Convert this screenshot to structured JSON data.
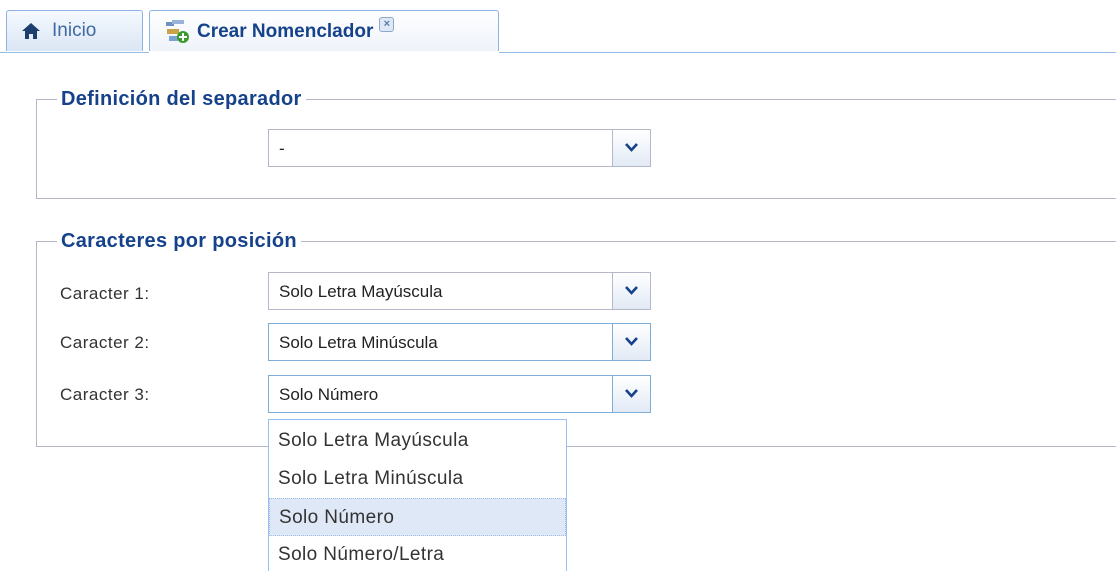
{
  "tabs": [
    {
      "label": "Inicio",
      "icon": "home-icon"
    },
    {
      "label": "Crear Nomenclador",
      "icon": "add-nomenclator-icon",
      "closable": true
    }
  ],
  "separator_section": {
    "legend": "Definición del separador",
    "combo_value": "-"
  },
  "chars_section": {
    "legend": "Caracteres por posición",
    "rows": [
      {
        "label": "Caracter 1:",
        "value": "Solo Letra Mayúscula"
      },
      {
        "label": "Caracter 2:",
        "value": "Solo Letra Minúscula"
      },
      {
        "label": "Caracter 3:",
        "value": "Solo Número"
      }
    ]
  },
  "dropdown": {
    "options": [
      "Solo Letra Mayúscula",
      "Solo Letra Minúscula",
      "Solo Número",
      "Solo Número/Letra"
    ],
    "selected": "Solo Número"
  },
  "colors": {
    "accent": "#15428b",
    "border": "#99bbe8",
    "selection": "#dfe8f6"
  }
}
